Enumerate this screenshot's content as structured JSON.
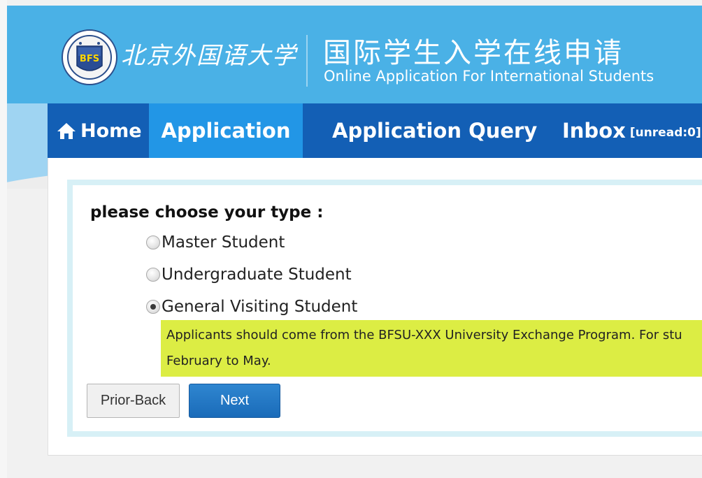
{
  "header": {
    "logo_text": "北京外国语大学",
    "title_cn": "国际学生入学在线申请",
    "title_en": "Online Application For International Students",
    "logo_initials": "BFS"
  },
  "nav": {
    "home": "Home",
    "application": "Application",
    "query": "Application Query",
    "inbox": "Inbox",
    "unread": "[unread:0]"
  },
  "form": {
    "prompt": "please choose your type :",
    "options": [
      {
        "label": "Master Student",
        "checked": false
      },
      {
        "label": "Undergraduate Student",
        "checked": false
      },
      {
        "label": "General Visiting Student",
        "checked": true
      }
    ],
    "notice_line1": "Applicants should come from the BFSU-XXX University Exchange Program. For stu",
    "notice_line2": "February to May.",
    "back_label": "Prior-Back",
    "next_label": "Next"
  },
  "colors": {
    "header_blue": "#4ab1e6",
    "nav_blue": "#135fb5",
    "nav_active": "#2296e6",
    "notice_bg": "#dced44",
    "button_blue": "#1a6bb9"
  }
}
